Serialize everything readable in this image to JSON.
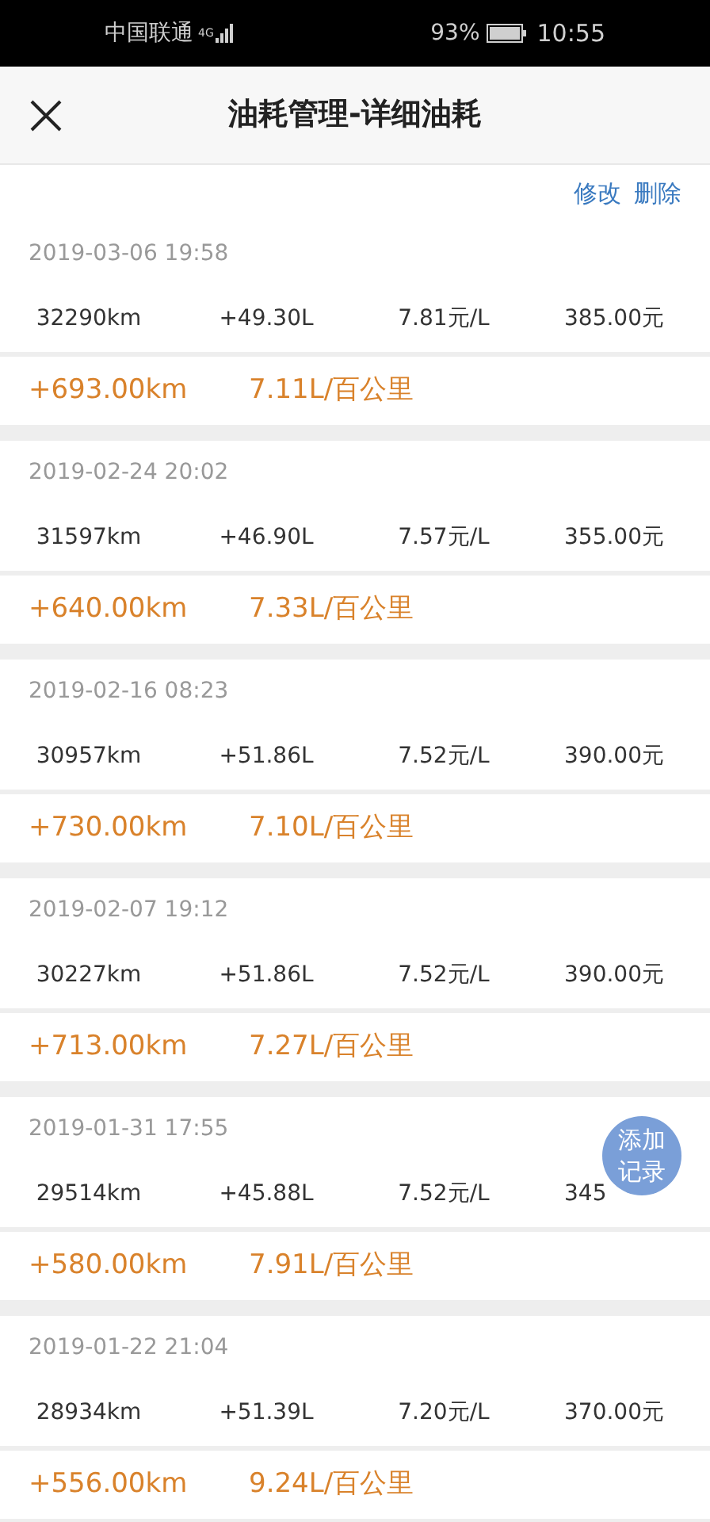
{
  "status_bar": {
    "carrier": "中国联通",
    "network": "4G",
    "battery": "93%",
    "time": "10:55"
  },
  "header": {
    "title": "油耗管理-详细油耗"
  },
  "actions": [
    "修改",
    "删除"
  ],
  "records": [
    {
      "date": "2019-03-06 19:58",
      "odometer": "32290km",
      "fuel": "+49.30L",
      "price": "7.81元/L",
      "cost": "385.00元",
      "distance": "+693.00km",
      "consumption": "7.11L/百公里"
    },
    {
      "date": "2019-02-24 20:02",
      "odometer": "31597km",
      "fuel": "+46.90L",
      "price": "7.57元/L",
      "cost": "355.00元",
      "distance": "+640.00km",
      "consumption": "7.33L/百公里"
    },
    {
      "date": "2019-02-16 08:23",
      "odometer": "30957km",
      "fuel": "+51.86L",
      "price": "7.52元/L",
      "cost": "390.00元",
      "distance": "+730.00km",
      "consumption": "7.10L/百公里"
    },
    {
      "date": "2019-02-07 19:12",
      "odometer": "30227km",
      "fuel": "+51.86L",
      "price": "7.52元/L",
      "cost": "390.00元",
      "distance": "+713.00km",
      "consumption": "7.27L/百公里"
    },
    {
      "date": "2019-01-31 17:55",
      "odometer": "29514km",
      "fuel": "+45.88L",
      "price": "7.52元/L",
      "cost": "345",
      "distance": "+580.00km",
      "consumption": "7.91L/百公里"
    },
    {
      "date": "2019-01-22 21:04",
      "odometer": "28934km",
      "fuel": "+51.39L",
      "price": "7.20元/L",
      "cost": "370.00元",
      "distance": "+556.00km",
      "consumption": "9.24L/百公里"
    }
  ],
  "fab": {
    "label": "添加记录"
  }
}
